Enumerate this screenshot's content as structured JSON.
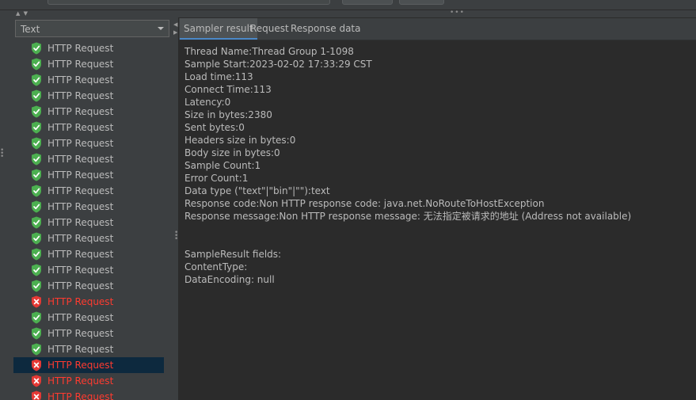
{
  "left_panel": {
    "renderer_select": {
      "value": "Text"
    },
    "results": [
      {
        "label": "HTTP Request",
        "status": "success"
      },
      {
        "label": "HTTP Request",
        "status": "success"
      },
      {
        "label": "HTTP Request",
        "status": "success"
      },
      {
        "label": "HTTP Request",
        "status": "success"
      },
      {
        "label": "HTTP Request",
        "status": "success"
      },
      {
        "label": "HTTP Request",
        "status": "success"
      },
      {
        "label": "HTTP Request",
        "status": "success"
      },
      {
        "label": "HTTP Request",
        "status": "success"
      },
      {
        "label": "HTTP Request",
        "status": "success"
      },
      {
        "label": "HTTP Request",
        "status": "success"
      },
      {
        "label": "HTTP Request",
        "status": "success"
      },
      {
        "label": "HTTP Request",
        "status": "success"
      },
      {
        "label": "HTTP Request",
        "status": "success"
      },
      {
        "label": "HTTP Request",
        "status": "success"
      },
      {
        "label": "HTTP Request",
        "status": "success"
      },
      {
        "label": "HTTP Request",
        "status": "success"
      },
      {
        "label": "HTTP Request",
        "status": "error"
      },
      {
        "label": "HTTP Request",
        "status": "success"
      },
      {
        "label": "HTTP Request",
        "status": "success"
      },
      {
        "label": "HTTP Request",
        "status": "success"
      },
      {
        "label": "HTTP Request",
        "status": "error",
        "selected": true
      },
      {
        "label": "HTTP Request",
        "status": "error"
      },
      {
        "label": "HTTP Request",
        "status": "error"
      }
    ]
  },
  "tabs": [
    {
      "label": "Sampler result",
      "active": true
    },
    {
      "label": "Request",
      "active": false
    },
    {
      "label": "Response data",
      "active": false
    }
  ],
  "sampler_result": {
    "lines": [
      "Thread Name:Thread Group 1-1098",
      "Sample Start:2023-02-02 17:33:29 CST",
      "Load time:113",
      "Connect Time:113",
      "Latency:0",
      "Size in bytes:2380",
      "Sent bytes:0",
      "Headers size in bytes:0",
      "Body size in bytes:0",
      "Sample Count:1",
      "Error Count:1",
      "Data type (\"text\"|\"bin\"|\"\"):text",
      "Response code:Non HTTP response code: java.net.NoRouteToHostException",
      "Response message:Non HTTP response message: 无法指定被请求的地址 (Address not available)",
      "",
      "",
      "SampleResult fields:",
      "ContentType: ",
      "DataEncoding: null"
    ]
  },
  "colors": {
    "background": "#3c3f41",
    "content_bg": "#2b2b2b",
    "text": "#bbbbbb",
    "error_text": "#ff3b30",
    "success_icon": "#4caf50",
    "error_icon": "#e53935",
    "selection": "#0d293e",
    "tab_accent": "#4a88c7"
  }
}
